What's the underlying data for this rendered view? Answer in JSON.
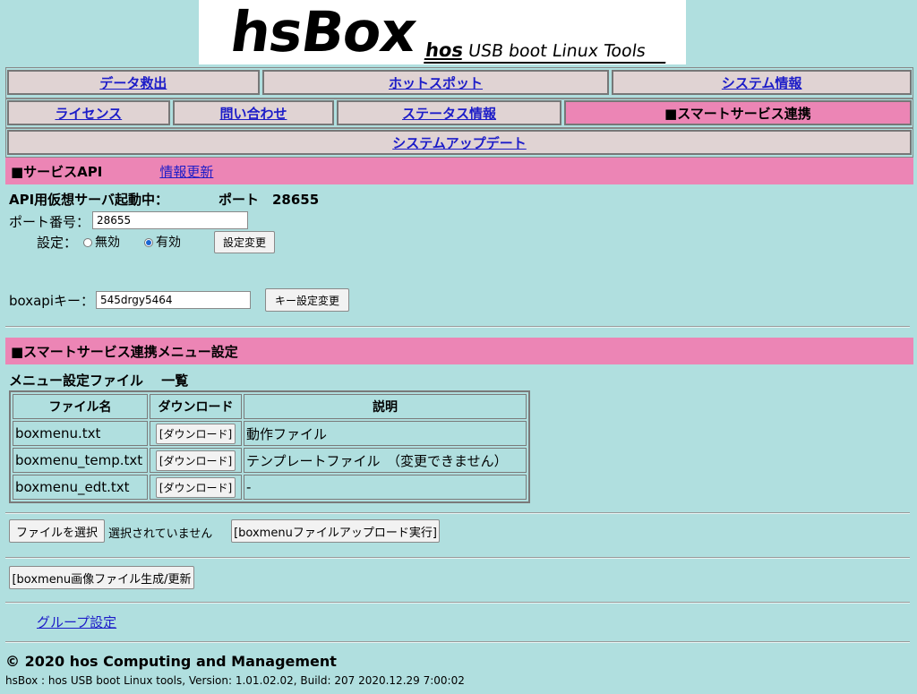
{
  "logo": {
    "main": "hsBox",
    "sub_bold": "hos",
    "sub_rest": " USB boot Linux Tools"
  },
  "nav": {
    "row1": [
      "データ救出",
      "ホットスポット",
      "システム情報"
    ],
    "row2": [
      "ライセンス",
      "問い合わせ",
      "ステータス情報",
      "■スマートサービス連携"
    ],
    "row3": [
      "システムアップデート"
    ]
  },
  "service_api": {
    "header": "■サービスAPI",
    "refresh_link": "情報更新",
    "status_label": "API用仮想サーバ起動中：",
    "port_status": "ポート　28655",
    "port_label": "ポート番号：",
    "port_value": "28655",
    "setting_label": "設定：",
    "option_off": "無効",
    "option_on": "有効",
    "apply_button": "設定変更",
    "key_label": "boxapiキー：",
    "key_value": "545drgy5464",
    "key_button": "キー設定変更"
  },
  "menu_settings": {
    "header": "■スマートサービス連携メニュー設定",
    "list_title": "メニュー設定ファイル　 一覧",
    "columns": [
      "ファイル名",
      "ダウンロード",
      "説明"
    ],
    "rows": [
      {
        "file": "boxmenu.txt",
        "download": "[ダウンロード]",
        "desc": "動作ファイル"
      },
      {
        "file": "boxmenu_temp.txt",
        "download": "[ダウンロード]",
        "desc": "テンプレートファイル　（変更できません）"
      },
      {
        "file": "boxmenu_edt.txt",
        "download": "[ダウンロード]",
        "desc": "-"
      }
    ],
    "choose_file": "ファイルを選択",
    "no_file": "選択されていません",
    "upload_button": "[boxmenuファイルアップロード実行]",
    "image_button": "[boxmenu画像ファイル生成/更新",
    "group_link": "グループ設定"
  },
  "footer": {
    "copyright": "© 2020 hos Computing and Management",
    "version": "hsBox : hos USB boot Linux tools, Version: 1.01.02.02, Build: 207 2020.12.29 7:00:02"
  }
}
